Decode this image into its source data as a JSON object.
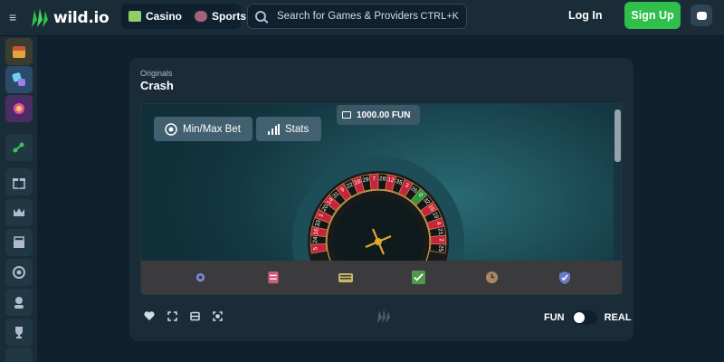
{
  "header": {
    "brand": "wild.io",
    "casino_label": "Casino",
    "sports_label": "Sports",
    "search_placeholder": "Search for Games & Providers",
    "search_shortcut": "CTRL+K",
    "login_label": "Log In",
    "signup_label": "Sign Up",
    "colors": {
      "signup": "#2fbf4a",
      "background": "#1a2c38"
    }
  },
  "sidebar": {
    "items": [
      {
        "icon": "treasure-chest-icon"
      },
      {
        "icon": "dice-icon"
      },
      {
        "icon": "candy-icon"
      },
      {
        "icon": "referral-icon"
      },
      {
        "icon": "gift-icon"
      },
      {
        "icon": "crown-icon"
      },
      {
        "icon": "chest-icon"
      },
      {
        "icon": "chip-icon"
      },
      {
        "icon": "support-icon"
      },
      {
        "icon": "trophy-icon"
      }
    ]
  },
  "game": {
    "category": "Originals",
    "title": "Crash",
    "balance": "1000.00 FUN",
    "minmax_label": "Min/Max Bet",
    "stats_label": "Stats",
    "wheel_numbers": [
      "5",
      "24",
      "16",
      "33",
      "1",
      "20",
      "14",
      "31",
      "9",
      "22",
      "18",
      "29",
      "7",
      "28",
      "12",
      "35",
      "3",
      "26",
      "0",
      "32",
      "15",
      "19",
      "4",
      "21",
      "2",
      "25"
    ],
    "toolbar_icons": [
      "settings-icon",
      "notes-icon",
      "keyboard-icon",
      "checklist-icon",
      "history-icon",
      "shield-icon"
    ]
  },
  "footer": {
    "icons": [
      "heart-icon",
      "fullscreen-icon",
      "theater-icon",
      "focus-icon"
    ],
    "fun_label": "FUN",
    "real_label": "REAL"
  }
}
